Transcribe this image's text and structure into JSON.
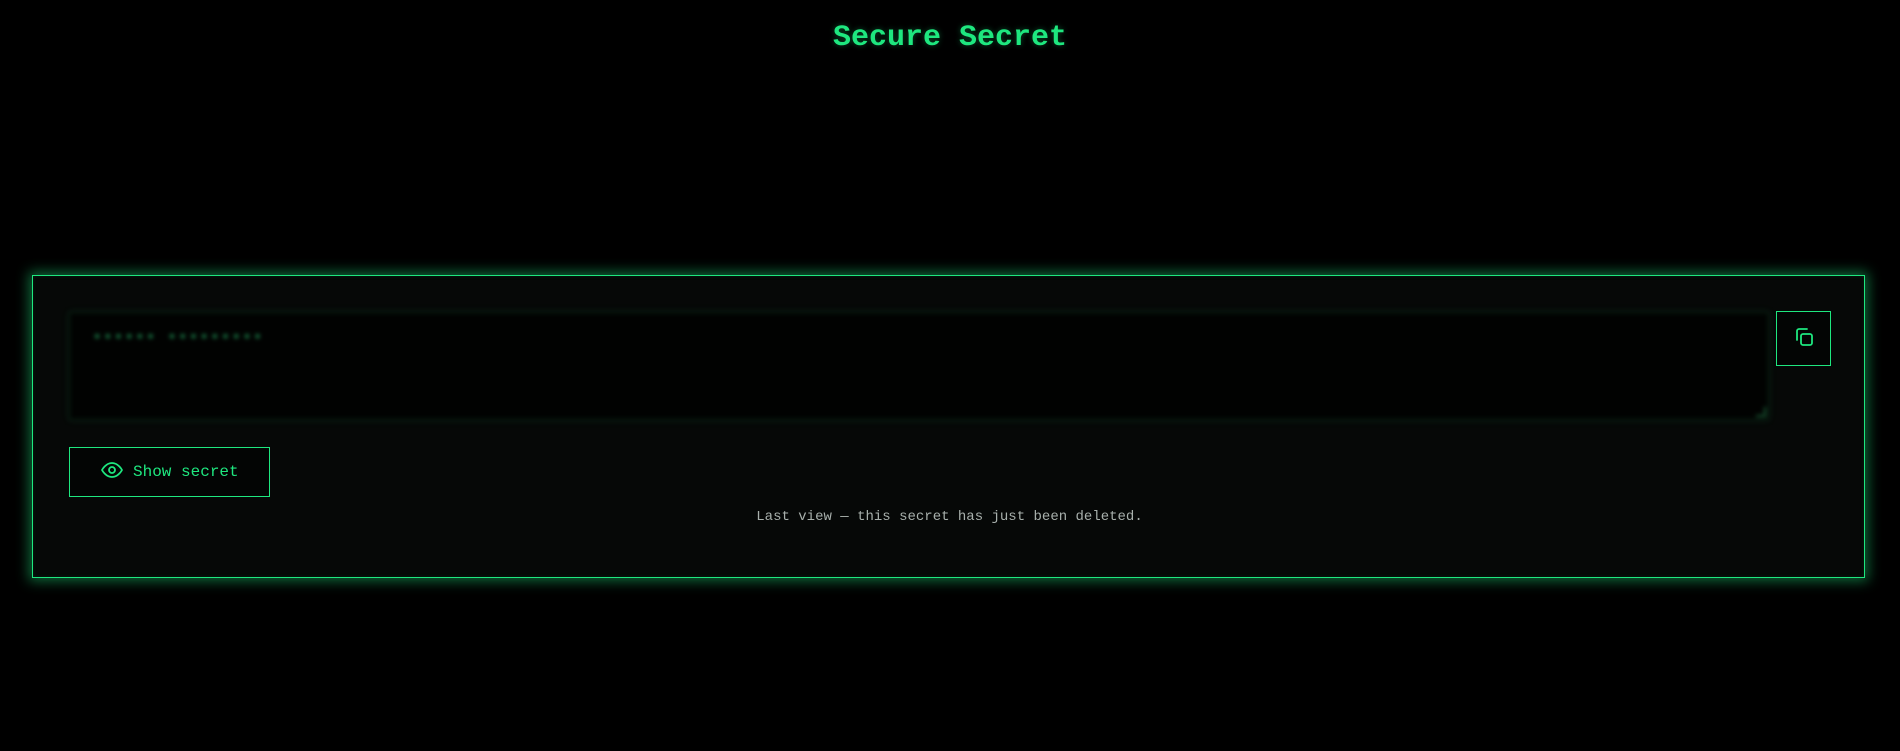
{
  "header": {
    "title": "Secure Secret"
  },
  "secret": {
    "value": "•••••• •••••••••"
  },
  "actions": {
    "copy_icon": "copy-icon",
    "show_label": "Show secret",
    "show_icon": "eye-icon"
  },
  "status": {
    "message": "Last view — this secret has just been deleted."
  },
  "colors": {
    "accent": "#1ee77f",
    "background": "#000000",
    "card": "#060807",
    "muted_text": "#a8b0ac"
  }
}
